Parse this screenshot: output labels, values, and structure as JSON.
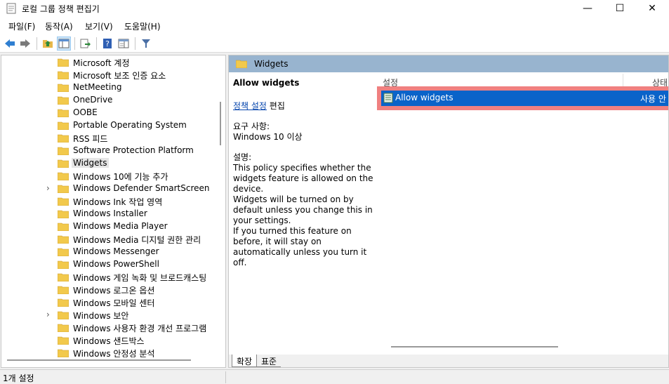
{
  "window": {
    "title": "로컬 그룹 정책 편집기",
    "minimize": "—",
    "maximize": "☐",
    "close": "✕"
  },
  "menu": [
    "파일(F)",
    "동작(A)",
    "보기(V)",
    "도움말(H)"
  ],
  "toolbar": {
    "icons": [
      "back-icon",
      "forward-icon",
      "up-folder-icon",
      "show-hide-tree-icon",
      "export-list-icon",
      "help-icon",
      "properties-view-icon",
      "filter-icon"
    ]
  },
  "tree": {
    "items": [
      {
        "label": "Microsoft 계정",
        "expand": ""
      },
      {
        "label": "Microsoft 보조 인증 요소",
        "expand": ""
      },
      {
        "label": "NetMeeting",
        "expand": ""
      },
      {
        "label": "OneDrive",
        "expand": ""
      },
      {
        "label": "OOBE",
        "expand": ""
      },
      {
        "label": "Portable Operating System",
        "expand": ""
      },
      {
        "label": "RSS 피드",
        "expand": ""
      },
      {
        "label": "Software Protection Platform",
        "expand": ""
      },
      {
        "label": "Widgets",
        "expand": "",
        "selected": true
      },
      {
        "label": "Windows 10에 기능 추가",
        "expand": ""
      },
      {
        "label": "Windows Defender SmartScreen",
        "expand": "›"
      },
      {
        "label": "Windows Ink 작업 영역",
        "expand": ""
      },
      {
        "label": "Windows Installer",
        "expand": ""
      },
      {
        "label": "Windows Media Player",
        "expand": ""
      },
      {
        "label": "Windows Media 디지털 권한 관리",
        "expand": ""
      },
      {
        "label": "Windows Messenger",
        "expand": ""
      },
      {
        "label": "Windows PowerShell",
        "expand": ""
      },
      {
        "label": "Windows 게임 녹화 및 브로드캐스팅",
        "expand": ""
      },
      {
        "label": "Windows 로그온 옵션",
        "expand": ""
      },
      {
        "label": "Windows 모바일 센터",
        "expand": ""
      },
      {
        "label": "Windows 보안",
        "expand": "›"
      },
      {
        "label": "Windows 사용자 환경 개선 프로그램",
        "expand": ""
      },
      {
        "label": "Windows 샌드박스",
        "expand": ""
      },
      {
        "label": "Windows 안정성 분석",
        "expand": ""
      }
    ]
  },
  "right": {
    "header": "Widgets",
    "desc": {
      "title": "Allow widgets",
      "link": "정책 설정",
      "link_suffix": " 편집",
      "req_label": "요구 사항:",
      "req_value": "Windows 10 이상",
      "desc_label": "설명:",
      "desc_p1": "This policy specifies whether the widgets feature is allowed on the device.",
      "desc_p2": "Widgets will be turned on by default unless you change this in your settings.",
      "desc_p3": "If you turned this feature on before, it will stay on automatically unless you turn it off."
    },
    "list": {
      "col_setting": "설정",
      "col_state": "상태",
      "row_name": "Allow widgets",
      "row_state": "사용 안"
    },
    "tabs": {
      "extended": "확장",
      "standard": "표준"
    }
  },
  "status": {
    "text": "1개 설정"
  },
  "colors": {
    "selection": "#0a63c9",
    "highlight_frame": "#f08080",
    "header_band": "#98b4cf",
    "folder": "#f2c94c"
  }
}
